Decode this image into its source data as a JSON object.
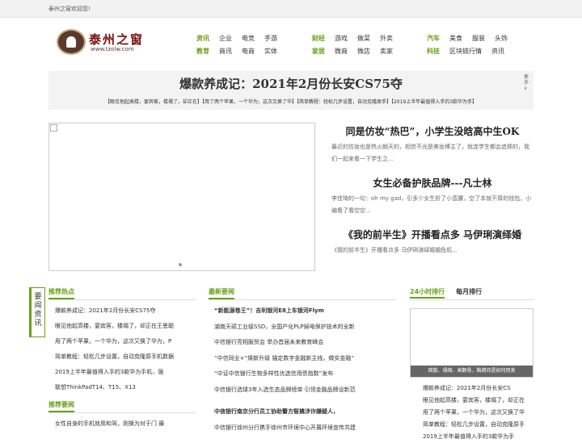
{
  "topbar": {
    "welcome": "泰州之窗欢迎您!"
  },
  "logo": {
    "name": "泰州之窗",
    "url": "www.tzolw.com"
  },
  "nav": {
    "group1": {
      "row1": [
        "资讯",
        "企业",
        "电竞",
        "手游"
      ],
      "row2": [
        "教育",
        "商讯",
        "电商",
        "实体"
      ]
    },
    "group2": {
      "row1": [
        "财经",
        "游戏",
        "做菜",
        "外卖"
      ],
      "row2": [
        "家居",
        "微商",
        "微店",
        "卖家"
      ]
    },
    "group3": {
      "row1": [
        "汽车",
        "美食",
        "服装",
        "头饰"
      ],
      "row2": [
        "科技",
        "区块链行情",
        "资讯"
      ]
    }
  },
  "promo": {
    "headline": "爆款养成记：2021年2月份长安CS75夺",
    "links": "【眼见他起高楼，宴宾客，楼塌了，却正在】【用了两个苹果，一个华为，这次又换了华】【简单教程：轻松几步设置，自动克隆原手】【2019上半年最值得入手的3款华为手】",
    "more": "更多"
  },
  "features": [
    {
      "title": "同是仿妆“热巴”，小学生没晗高中生OK",
      "desc": "最近的仿妆也是热火朝天的，相信不光是美妆博主了，就连学生都会追捧的，我们一起来看一下学生之..."
    },
    {
      "title": "女生必备护肤品牌---凡士林",
      "desc": "李佳琦的一句：oh my gad，引多少女生折了小蛮腰，空了本就不厚的钱包。小编看了看空空..."
    },
    {
      "title": "《我的前半生》开播看点多 马伊琍演绎婚",
      "desc": "《我的前半生》开播看点多 马伊琍演绎婚姻危机..."
    }
  ],
  "sidetab": "要闻资讯",
  "hot": {
    "title": "推荐热点",
    "items": [
      "爆款养成记：2021年2月份长安CS75夺",
      "眼见他起高楼，宴宾客，楼塌了，却正在王思聪",
      "用了两个苹果，一个华为，这次又换了华为，P",
      "简单教程：轻松几步设置，自动克隆原手机数据",
      "2019上半年最值得入手的3款华为手机，强",
      "联想ThinkPadT14、T15、X13"
    ],
    "title2": "推荐要闻",
    "items2": [
      "女性自身的手机就用和驾，则换为对于门 最"
    ]
  },
  "news": {
    "title": "最新要闻",
    "items": [
      "“新能源卷王”！吉利银河E8上车银河Flym",
      "湖南天硕工业级SSD，全国产化PLP掉电保护技术的全新",
      "中信银行亮相服贸会 举办首届未来教育峰会",
      "“中信同业+”焕新升级 锚定数字金融新主线，做实金融”",
      "“中证中信银行生物多样性优选信用债指数”发布",
      "中信银行选球3年入选生态品牌榜单 引领金融品牌设新范"
    ],
    "items2": [
      "中信银行南京分行员工协助警方智擒涉诈嫌疑人，",
      "中信银行徐州分行携手徐州市环境中心开展环境宣传共建"
    ]
  },
  "rank": {
    "tab_active": "24小时排行",
    "tab2": "每月排行",
    "thumb_caption": "疏散、塌缩、高颧骨，鞠婧祎是如何用美",
    "items": [
      "爆款养成记：2021年2月份长安CS",
      "眼见他起高楼，宴宾客，楼塌了，却正在",
      "用了两个苹果，一个华为，这次又换了华",
      "简单教程：轻松几步设置，自动克隆原手",
      "2019上半年最值得入手的3款华为手"
    ]
  }
}
